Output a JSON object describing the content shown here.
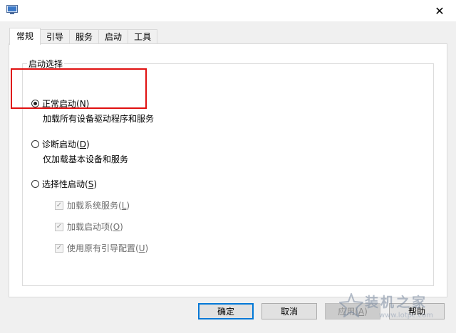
{
  "window": {
    "app_icon": "msconfig-icon",
    "close_label": "✕"
  },
  "tabs": [
    {
      "label": "常规",
      "active": true
    },
    {
      "label": "引导",
      "active": false
    },
    {
      "label": "服务",
      "active": false
    },
    {
      "label": "启动",
      "active": false
    },
    {
      "label": "工具",
      "active": false
    }
  ],
  "startup_group": {
    "legend": "启动选择",
    "options": [
      {
        "label": "正常启动(",
        "accel": "N",
        "suffix": ")",
        "description": "加载所有设备驱动程序和服务",
        "checked": true
      },
      {
        "label": "诊断启动(",
        "accel": "D",
        "suffix": ")",
        "description": "仅加载基本设备和服务",
        "checked": false
      },
      {
        "label": "选择性启动(",
        "accel": "S",
        "suffix": ")",
        "checked": false
      }
    ],
    "selective_items": [
      {
        "label": "加载系统服务(",
        "accel": "L",
        "suffix": ")",
        "checked": true,
        "enabled": false
      },
      {
        "label": "加载启动项(",
        "accel": "O",
        "suffix": ")",
        "checked": true,
        "enabled": false
      },
      {
        "label": "使用原有引导配置(",
        "accel": "U",
        "suffix": ")",
        "checked": true,
        "enabled": false
      }
    ]
  },
  "buttons": {
    "ok": "确定",
    "cancel": "取消",
    "apply": "应用(",
    "apply_accel": "A",
    "apply_suffix": ")",
    "help": "帮助"
  },
  "watermark": {
    "title": "装机之家",
    "url": "www.lotpc.com"
  },
  "colors": {
    "highlight": "#e01010",
    "default_button_border": "#0078d7"
  }
}
